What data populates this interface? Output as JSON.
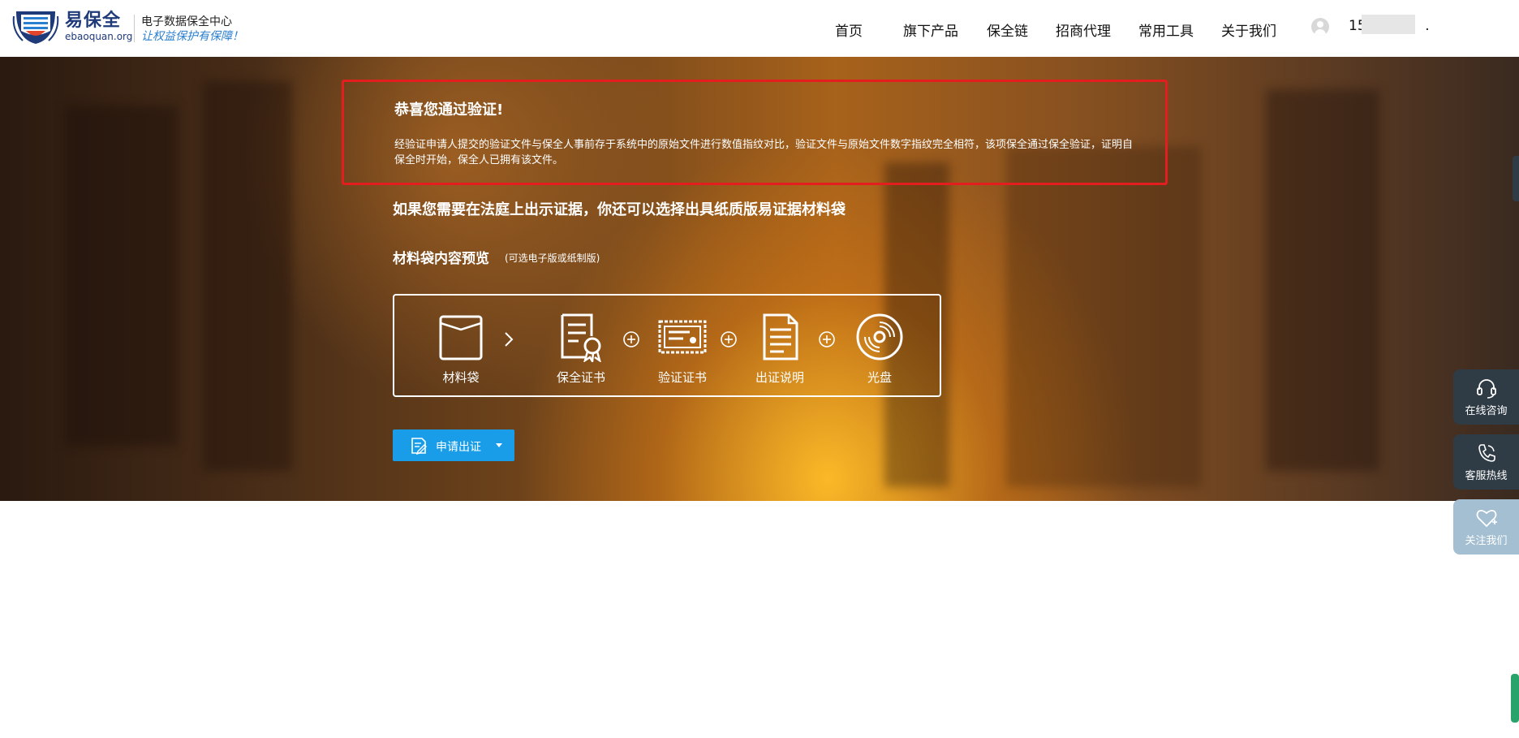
{
  "header": {
    "brand_name": "易保全",
    "brand_domain": "ebaoquan.org",
    "brand_subtitle": "电子数据保全中心",
    "brand_slogan": "让权益保护有保障！",
    "nav": [
      "首页",
      "旗下产品",
      "保全链",
      "招商代理",
      "常用工具",
      "关于我们"
    ],
    "user_id": "15(",
    "user_suffix": "."
  },
  "verify": {
    "title": "恭喜您通过验证!",
    "text": "经验证申请人提交的验证文件与保全人事前存于系统中的原始文件进行数值指纹对比，验证文件与原始文件数字指纹完全相符，该项保全通过保全验证，证明自保全时开始，保全人已拥有该文件。"
  },
  "court_text": "如果您需要在法庭上出示证据，你还可以选择出具纸质版易证据材料袋",
  "preview": {
    "title": "材料袋内容预览",
    "subtitle": "(可选电子版或纸制版)"
  },
  "package_items": [
    {
      "label": "材料袋",
      "icon": "folder-icon"
    },
    {
      "label": "保全证书",
      "icon": "certificate-icon"
    },
    {
      "label": "验证证书",
      "icon": "verify-certificate-icon"
    },
    {
      "label": "出证说明",
      "icon": "document-icon"
    },
    {
      "label": "光盘",
      "icon": "disc-icon"
    }
  ],
  "apply_button": {
    "label": "申请出证",
    "icon": "certificate-pen-icon"
  },
  "float_panel": [
    {
      "label": "在线咨询",
      "icon": "headset-icon"
    },
    {
      "label": "客服热线",
      "icon": "phone-icon"
    },
    {
      "label": "关注我们",
      "icon": "heart-plus-icon"
    }
  ],
  "colors": {
    "alert_border": "#e41e1e",
    "button_blue": "#1a9de8",
    "float_dark": "#2f3b45",
    "float_light": "#a3bfd1",
    "brand_blue": "#1e3a78"
  }
}
